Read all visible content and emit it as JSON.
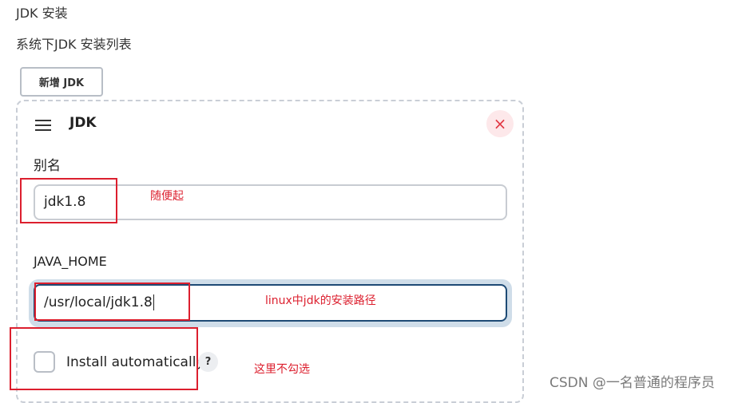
{
  "section": {
    "title": "JDK 安装",
    "description": "系统下JDK 安装列表",
    "add_button_label": "新增 JDK"
  },
  "card": {
    "title": "JDK",
    "remove_icon": "×",
    "alias_label": "别名",
    "alias_value": "jdk1.8",
    "java_home_label": "JAVA_HOME",
    "java_home_value": "/usr/local/jdk1.8",
    "install_label": "Install automatically",
    "install_checked": false,
    "help_icon": "?"
  },
  "annotations": {
    "alias_note": "随便起",
    "java_home_note": "linux中jdk的安装路径",
    "install_note": "这里不勾选",
    "color": "#dc1f2e"
  },
  "watermark": "CSDN @一名普通的程序员"
}
